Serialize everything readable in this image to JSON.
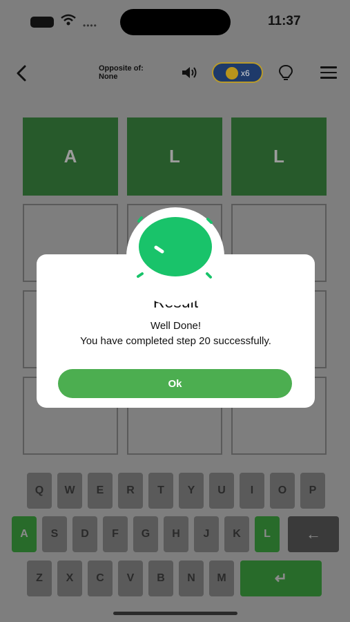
{
  "status_bar": {
    "time": "11:37"
  },
  "header": {
    "opposite_label": "Opposite of:",
    "opposite_value": "None",
    "coins": "x6",
    "back_icon": "chevron-left-icon",
    "sound_icon": "speaker-icon",
    "hint_icon": "lightbulb-icon",
    "menu_icon": "hamburger-icon"
  },
  "grid": {
    "rows": [
      [
        "A",
        "L",
        "L"
      ],
      [
        "",
        "",
        ""
      ],
      [
        "",
        "",
        ""
      ],
      [
        "",
        "",
        ""
      ]
    ]
  },
  "keyboard": {
    "row1": [
      "Q",
      "W",
      "E",
      "R",
      "T",
      "Y",
      "U",
      "I",
      "O",
      "P"
    ],
    "row2": [
      "A",
      "S",
      "D",
      "F",
      "G",
      "H",
      "J",
      "K",
      "L"
    ],
    "row3": [
      "Z",
      "X",
      "C",
      "V",
      "B",
      "N",
      "M"
    ],
    "backspace": "←",
    "enter": "↵"
  },
  "modal": {
    "title": "Result",
    "line1": "Well Done!",
    "line2": "You have completed step 20 successfully.",
    "ok_label": "Ok"
  },
  "colors": {
    "accent_green": "#4cae50",
    "tile_green": "#275a2b",
    "success_icon": "#19c36a"
  }
}
